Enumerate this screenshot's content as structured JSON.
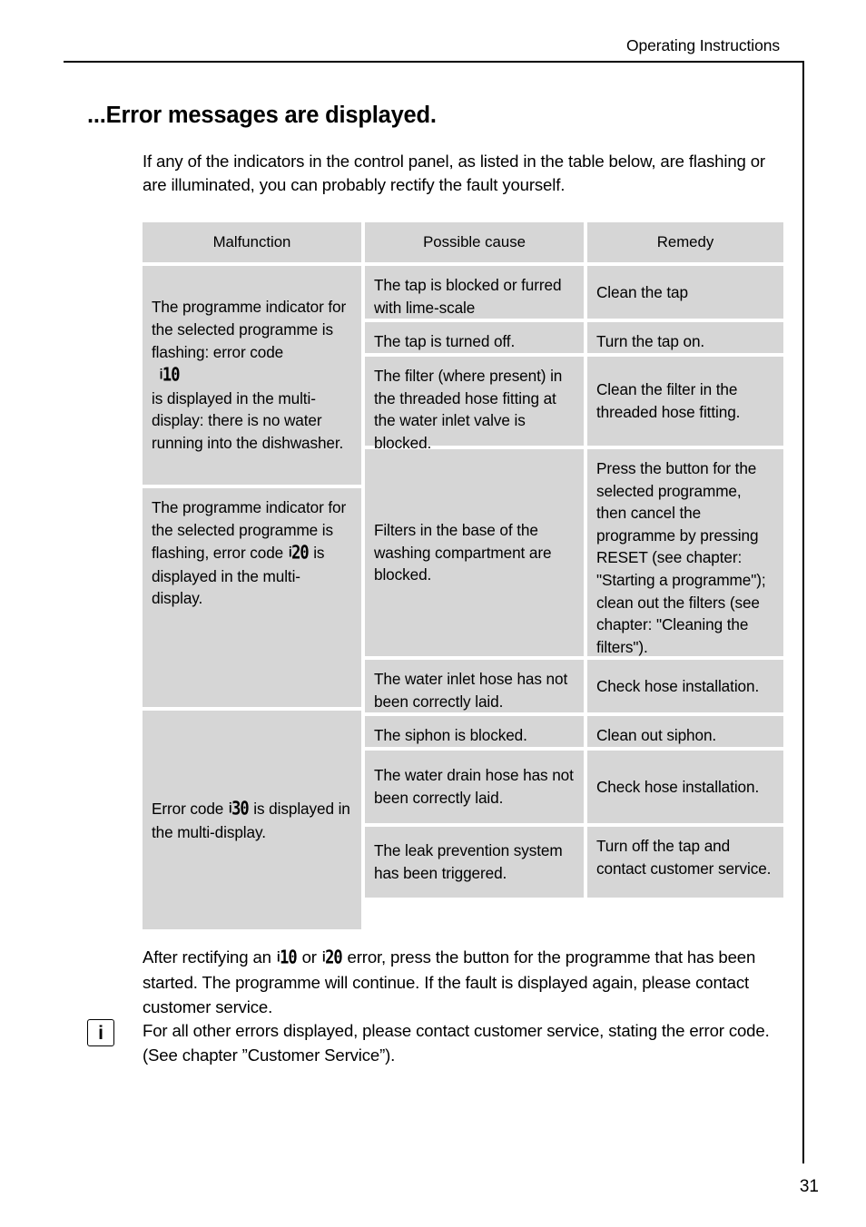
{
  "header": {
    "running_title": "Operating Instructions"
  },
  "page": {
    "title": "...Error messages are displayed.",
    "number": "31"
  },
  "intro": "If any of the indicators in the control panel, as listed in the table below, are flashing or are illuminated, you can probably rectify the fault yourself.",
  "table": {
    "columns": [
      "Malfunction",
      "Possible cause",
      "Remedy"
    ],
    "groups": [
      {
        "malfunction_pre": "The programme indicator for the selected programme is flashing: error code",
        "malfunction_code": "10",
        "malfunction_code_prefix": "i",
        "malfunction_post": "is displayed in the multi-display: there is no water running into the dishwasher.",
        "rows": [
          {
            "cause": "The tap is blocked or furred with lime-scale",
            "remedy": "Clean the tap"
          },
          {
            "cause": "The tap is turned off.",
            "remedy": "Turn the tap on."
          },
          {
            "cause": "The filter (where present) in the threaded hose fitting at the water inlet valve is blocked.",
            "remedy": "Clean the filter in the threaded hose fitting."
          },
          {
            "cause": "Filters in the base of the washing compartment are blocked.",
            "remedy": "Press the button for the selected programme, then cancel the programme by pressing RESET (see chapter: \"Starting a programme\"); clean out the filters (see chapter: \"Cleaning the filters\")."
          },
          {
            "cause": "The water inlet hose has not been correctly laid.",
            "remedy": "Check hose installation."
          }
        ]
      },
      {
        "malfunction_pre": "The programme indicator for the selected programme is flashing, error code",
        "malfunction_code": "20",
        "malfunction_code_prefix": "i",
        "malfunction_post": "is displayed in the multi-display.",
        "rows": [
          {
            "cause": "The siphon is blocked.",
            "remedy": "Clean out siphon."
          },
          {
            "cause": "The water drain hose has not been correctly laid.",
            "remedy": "Check hose installation."
          }
        ]
      },
      {
        "malfunction_pre": "Error code",
        "malfunction_code": "30",
        "malfunction_code_prefix": "i",
        "malfunction_post": "is displayed in the multi-display.",
        "rows": [
          {
            "cause": "The leak prevention system has been triggered.",
            "remedy": "Turn off the tap and contact customer service."
          }
        ]
      }
    ]
  },
  "after_table": {
    "part1": "After rectifying an",
    "code1": "10",
    "code1_prefix": "i",
    "part2": "or",
    "code2": "20",
    "code2_prefix": "i",
    "part3": "error, press the button for the programme that has been started. The programme will continue. If the fault is displayed again, please contact customer service."
  },
  "info_note": {
    "icon": "info-icon",
    "icon_glyph": "i",
    "text": "For all other errors displayed, please contact customer service, stating the error code. (See chapter ”Customer Service”)."
  }
}
